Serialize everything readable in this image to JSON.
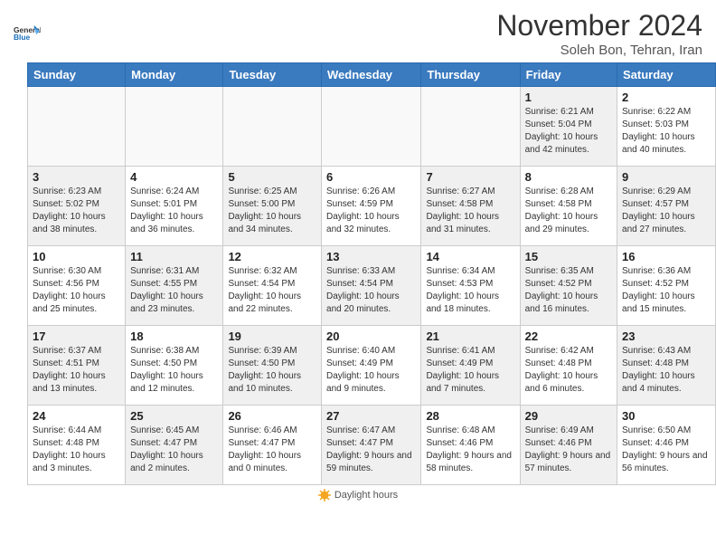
{
  "header": {
    "logo_text_general": "General",
    "logo_text_blue": "Blue",
    "month_title": "November 2024",
    "subtitle": "Soleh Bon, Tehran, Iran"
  },
  "columns": [
    "Sunday",
    "Monday",
    "Tuesday",
    "Wednesday",
    "Thursday",
    "Friday",
    "Saturday"
  ],
  "weeks": [
    [
      {
        "day": "",
        "info": ""
      },
      {
        "day": "",
        "info": ""
      },
      {
        "day": "",
        "info": ""
      },
      {
        "day": "",
        "info": ""
      },
      {
        "day": "",
        "info": ""
      },
      {
        "day": "1",
        "info": "Sunrise: 6:21 AM\nSunset: 5:04 PM\nDaylight: 10 hours and 42 minutes."
      },
      {
        "day": "2",
        "info": "Sunrise: 6:22 AM\nSunset: 5:03 PM\nDaylight: 10 hours and 40 minutes."
      }
    ],
    [
      {
        "day": "3",
        "info": "Sunrise: 6:23 AM\nSunset: 5:02 PM\nDaylight: 10 hours and 38 minutes."
      },
      {
        "day": "4",
        "info": "Sunrise: 6:24 AM\nSunset: 5:01 PM\nDaylight: 10 hours and 36 minutes."
      },
      {
        "day": "5",
        "info": "Sunrise: 6:25 AM\nSunset: 5:00 PM\nDaylight: 10 hours and 34 minutes."
      },
      {
        "day": "6",
        "info": "Sunrise: 6:26 AM\nSunset: 4:59 PM\nDaylight: 10 hours and 32 minutes."
      },
      {
        "day": "7",
        "info": "Sunrise: 6:27 AM\nSunset: 4:58 PM\nDaylight: 10 hours and 31 minutes."
      },
      {
        "day": "8",
        "info": "Sunrise: 6:28 AM\nSunset: 4:58 PM\nDaylight: 10 hours and 29 minutes."
      },
      {
        "day": "9",
        "info": "Sunrise: 6:29 AM\nSunset: 4:57 PM\nDaylight: 10 hours and 27 minutes."
      }
    ],
    [
      {
        "day": "10",
        "info": "Sunrise: 6:30 AM\nSunset: 4:56 PM\nDaylight: 10 hours and 25 minutes."
      },
      {
        "day": "11",
        "info": "Sunrise: 6:31 AM\nSunset: 4:55 PM\nDaylight: 10 hours and 23 minutes."
      },
      {
        "day": "12",
        "info": "Sunrise: 6:32 AM\nSunset: 4:54 PM\nDaylight: 10 hours and 22 minutes."
      },
      {
        "day": "13",
        "info": "Sunrise: 6:33 AM\nSunset: 4:54 PM\nDaylight: 10 hours and 20 minutes."
      },
      {
        "day": "14",
        "info": "Sunrise: 6:34 AM\nSunset: 4:53 PM\nDaylight: 10 hours and 18 minutes."
      },
      {
        "day": "15",
        "info": "Sunrise: 6:35 AM\nSunset: 4:52 PM\nDaylight: 10 hours and 16 minutes."
      },
      {
        "day": "16",
        "info": "Sunrise: 6:36 AM\nSunset: 4:52 PM\nDaylight: 10 hours and 15 minutes."
      }
    ],
    [
      {
        "day": "17",
        "info": "Sunrise: 6:37 AM\nSunset: 4:51 PM\nDaylight: 10 hours and 13 minutes."
      },
      {
        "day": "18",
        "info": "Sunrise: 6:38 AM\nSunset: 4:50 PM\nDaylight: 10 hours and 12 minutes."
      },
      {
        "day": "19",
        "info": "Sunrise: 6:39 AM\nSunset: 4:50 PM\nDaylight: 10 hours and 10 minutes."
      },
      {
        "day": "20",
        "info": "Sunrise: 6:40 AM\nSunset: 4:49 PM\nDaylight: 10 hours and 9 minutes."
      },
      {
        "day": "21",
        "info": "Sunrise: 6:41 AM\nSunset: 4:49 PM\nDaylight: 10 hours and 7 minutes."
      },
      {
        "day": "22",
        "info": "Sunrise: 6:42 AM\nSunset: 4:48 PM\nDaylight: 10 hours and 6 minutes."
      },
      {
        "day": "23",
        "info": "Sunrise: 6:43 AM\nSunset: 4:48 PM\nDaylight: 10 hours and 4 minutes."
      }
    ],
    [
      {
        "day": "24",
        "info": "Sunrise: 6:44 AM\nSunset: 4:48 PM\nDaylight: 10 hours and 3 minutes."
      },
      {
        "day": "25",
        "info": "Sunrise: 6:45 AM\nSunset: 4:47 PM\nDaylight: 10 hours and 2 minutes."
      },
      {
        "day": "26",
        "info": "Sunrise: 6:46 AM\nSunset: 4:47 PM\nDaylight: 10 hours and 0 minutes."
      },
      {
        "day": "27",
        "info": "Sunrise: 6:47 AM\nSunset: 4:47 PM\nDaylight: 9 hours and 59 minutes."
      },
      {
        "day": "28",
        "info": "Sunrise: 6:48 AM\nSunset: 4:46 PM\nDaylight: 9 hours and 58 minutes."
      },
      {
        "day": "29",
        "info": "Sunrise: 6:49 AM\nSunset: 4:46 PM\nDaylight: 9 hours and 57 minutes."
      },
      {
        "day": "30",
        "info": "Sunrise: 6:50 AM\nSunset: 4:46 PM\nDaylight: 9 hours and 56 minutes."
      }
    ]
  ],
  "legend": {
    "daylight_hours": "Daylight hours"
  }
}
